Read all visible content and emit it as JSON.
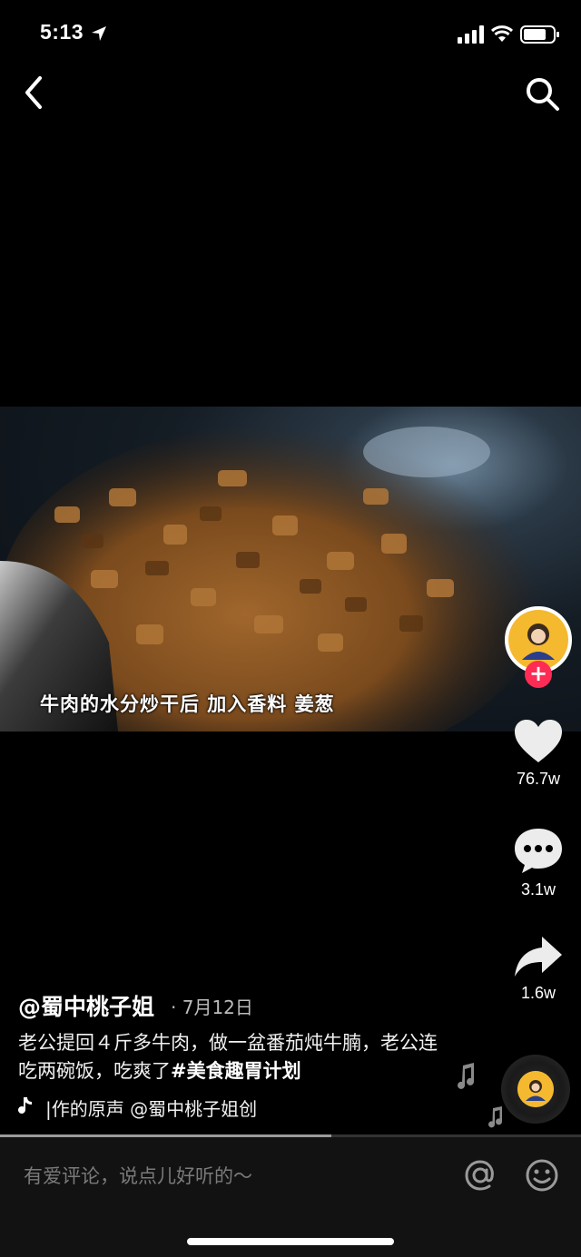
{
  "status_bar": {
    "time": "5:13"
  },
  "video": {
    "subtitle": "牛肉的水分炒干后  加入香料  姜葱"
  },
  "rail": {
    "avatar_caption": "蜀中桃子姐",
    "likes": "76.7w",
    "comments": "3.1w",
    "shares": "1.6w"
  },
  "post": {
    "author": "@蜀中桃子姐",
    "date": "· 7月12日",
    "description": "老公提回４斤多牛肉，做一盆番茄炖牛腩，老公连吃两碗饭，吃爽了",
    "hashtag": "#美食趣胃计划",
    "music": "|作的原声    @蜀中桃子姐创"
  },
  "playback": {
    "progress_fraction": 0.57
  },
  "comment_bar": {
    "placeholder": "有爱评论，说点儿好听的～"
  },
  "colors": {
    "accent": "#fe2c55",
    "background": "#000000"
  }
}
